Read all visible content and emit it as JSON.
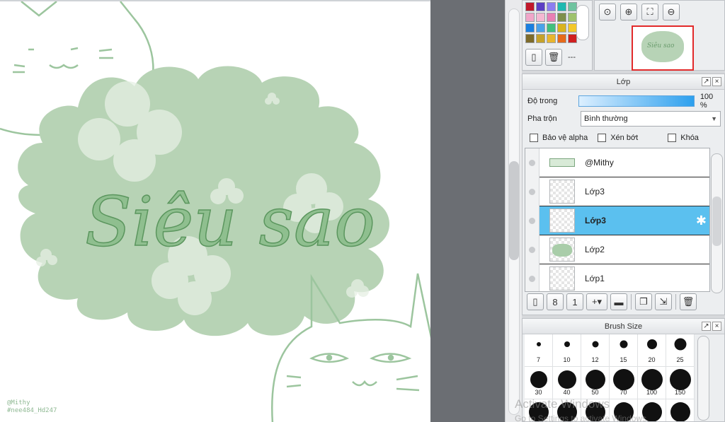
{
  "canvas": {
    "artwork_text": "Siêu sao",
    "signature_line1": "@Mithy",
    "signature_line2": "#nee484_Hd247"
  },
  "palette": {
    "swatches": [
      "#c0182a",
      "#5b3fc4",
      "#8b7df0",
      "#1fb8b0",
      "#6fc39f",
      "#f0a6c9",
      "#f4b8d2",
      "#e97fb4",
      "#7e8f4b",
      "#9fc26d",
      "#1a7fe0",
      "#4aa2ea",
      "#41c07d",
      "#d9b31e",
      "#f3c82a",
      "#7d6b2a",
      "#c5a22a",
      "#e8b52e",
      "#e66a1a",
      "#cf1f1f"
    ],
    "more_label": "---",
    "new_icon": "document-icon",
    "delete_icon": "trash-icon"
  },
  "navigator": {
    "tools": [
      "zoom-fit-icon",
      "zoom-in-icon",
      "fullscreen-icon",
      "zoom-out-icon"
    ],
    "thumb_text": "Siêu sao"
  },
  "layers": {
    "title": "Lớp",
    "opacity_label": "Độ trong",
    "opacity_value": "100 %",
    "blend_label": "Pha trộn",
    "blend_value": "Bình thường",
    "protect_alpha": "Bảo vệ alpha",
    "clipping": "Xén bớt",
    "lock": "Khóa",
    "items": [
      {
        "name": "@Mithy",
        "selected": false
      },
      {
        "name": "Lớp3",
        "selected": false
      },
      {
        "name": "Lớp3",
        "selected": true
      },
      {
        "name": "Lớp2",
        "selected": false
      },
      {
        "name": "Lớp1",
        "selected": false
      }
    ]
  },
  "brush_size": {
    "title": "Brush Size",
    "sizes": [
      "7",
      "10",
      "12",
      "15",
      "20",
      "25",
      "30",
      "40",
      "50",
      "70",
      "100",
      "150",
      "",
      "",
      "",
      "",
      "",
      ""
    ]
  },
  "watermark": {
    "line1": "Activate Windows",
    "line2": "Go to Settings to activate Windows."
  }
}
